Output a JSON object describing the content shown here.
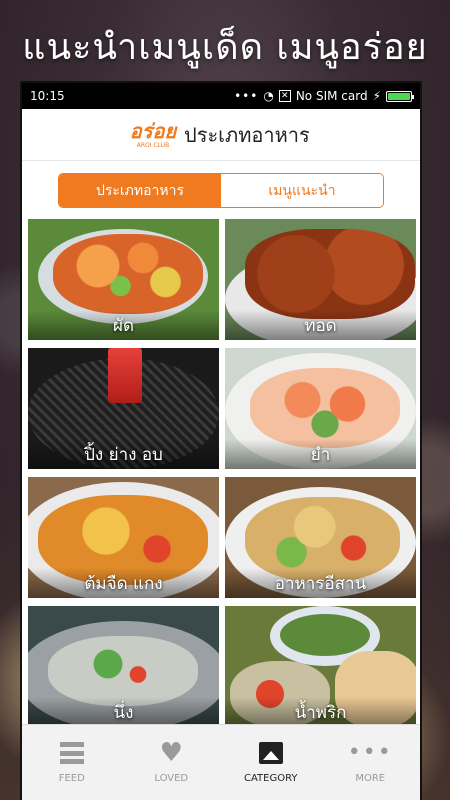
{
  "promo": {
    "title": "แนะนำเมนูเด็ด เมนูอร่อย"
  },
  "statusbar": {
    "time": "10:15",
    "network": "No SIM card",
    "icons": [
      "dots-icon",
      "wifi-icon",
      "sim-icon",
      "charging-icon",
      "battery-icon"
    ]
  },
  "appbar": {
    "logo_text": "อร่อย",
    "logo_subtext": "AROI CLUB",
    "title": "ประเภทอาหาร"
  },
  "tabs": [
    {
      "label": "ประเภทอาหาร",
      "active": true
    },
    {
      "label": "เมนูแนะนำ",
      "active": false
    }
  ],
  "categories": [
    {
      "label": "ผัด"
    },
    {
      "label": "ทอด"
    },
    {
      "label": "ปิ้ง ย่าง อบ"
    },
    {
      "label": "ยำ"
    },
    {
      "label": "ต้มจืด แกง"
    },
    {
      "label": "อาหารอีสาน"
    },
    {
      "label": "นึ่ง"
    },
    {
      "label": "น้ำพริก"
    }
  ],
  "bottomnav": [
    {
      "label": "FEED",
      "icon": "feed-icon",
      "active": false
    },
    {
      "label": "LOVED",
      "icon": "heart-icon",
      "active": false
    },
    {
      "label": "CATEGORY",
      "icon": "image-icon",
      "active": true
    },
    {
      "label": "MORE",
      "icon": "more-icon",
      "active": false
    }
  ],
  "colors": {
    "accent": "#f07a20",
    "statusbar_bg": "#000000",
    "nav_bg": "#f2f2f2"
  }
}
